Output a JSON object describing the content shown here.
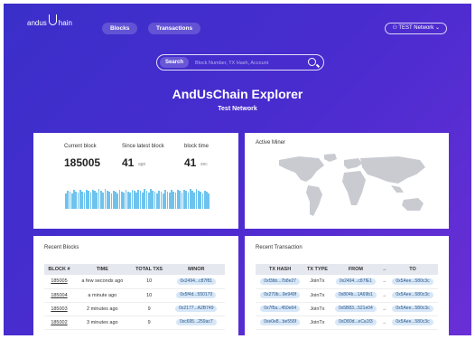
{
  "nav": {
    "logo_left": "andus",
    "logo_right": "hain",
    "blocks": "Blocks",
    "transactions": "Transactions",
    "network": "TEST Network"
  },
  "search": {
    "label": "Search",
    "placeholder": "Block Number, TX Hash, Account"
  },
  "hero": {
    "title": "AndUsChain Explorer",
    "subtitle": "Test Network"
  },
  "stats": {
    "current_block_label": "Current block",
    "current_block": "185005",
    "since_label": "Since latest block",
    "since_value": "41",
    "since_unit": "ago",
    "block_time_label": "block time",
    "block_time_value": "41",
    "block_time_unit": "sec"
  },
  "active_miner": {
    "title": "Active Miner"
  },
  "recent_blocks": {
    "title": "Recent Blocks",
    "headers": [
      "BLOCK #",
      "TIME",
      "TOTAL TXS",
      "MINOR"
    ],
    "rows": [
      {
        "block": "185005",
        "time": "a few seconds ago",
        "txs": "10",
        "miner": "0x2494...c87f81"
      },
      {
        "block": "185004",
        "time": "a minute ago",
        "txs": "10",
        "miner": "0x5f4d...550170"
      },
      {
        "block": "185003",
        "time": "2 minutes ago",
        "txs": "9",
        "miner": "0x2177...A2B749"
      },
      {
        "block": "185002",
        "time": "3 minutes ago",
        "txs": "9",
        "miner": "0xc695...259ac7"
      }
    ]
  },
  "recent_transactions": {
    "title": "Recent Transaction",
    "headers": [
      "TX HASH",
      "TX TYPE",
      "FROM",
      "→",
      "TO"
    ],
    "rows": [
      {
        "hash": "0xf3bb...7b8e27",
        "type": "JoinTx",
        "from": "0x2494...c87fE1",
        "to": "0x5Aee...580c3c"
      },
      {
        "hash": "0x270b...9e949f",
        "type": "JoinTx",
        "from": "0x804b...1A69b1",
        "to": "0x5Aee...580c3c"
      },
      {
        "hash": "0x7f5a...450e64",
        "type": "JoinTx",
        "from": "0x5B83...521e04",
        "to": "0x5Aee...580c3c"
      },
      {
        "hash": "0xe0e8...be556f",
        "type": "JoinTx",
        "from": "0xD80d...eCa1f3",
        "to": "0x5Aee...580c3c"
      }
    ]
  },
  "colors": {
    "hero": "#4a2ccf",
    "bars": "#6ec3ee",
    "pill": "#d7e7f8"
  }
}
